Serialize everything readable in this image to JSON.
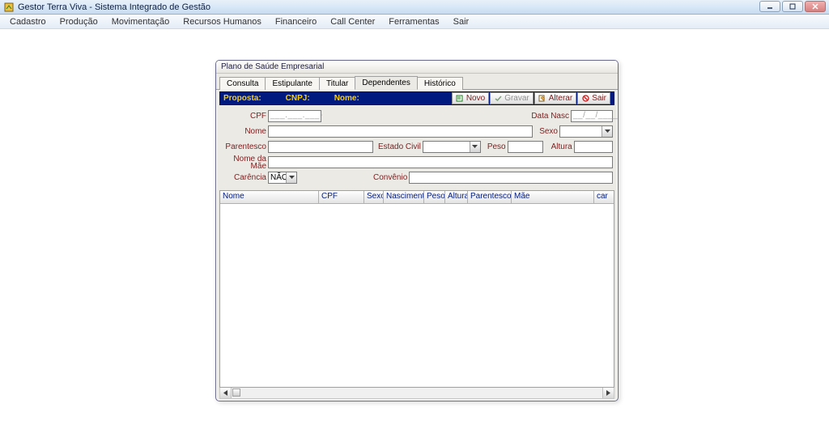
{
  "window": {
    "title": "Gestor Terra Viva - Sistema Integrado de Gestão"
  },
  "menu": {
    "items": [
      "Cadastro",
      "Produção",
      "Movimentação",
      "Recursos Humanos",
      "Financeiro",
      "Call Center",
      "Ferramentas",
      "Sair"
    ]
  },
  "panel": {
    "title": "Plano de Saúde Empresarial",
    "tabs": [
      "Consulta",
      "Estipulante",
      "Titular",
      "Dependentes",
      "Histórico"
    ],
    "active_tab_index": 3
  },
  "bluebar": {
    "proposta_label": "Proposta:",
    "cnpj_label": "CNPJ:",
    "nome_label": "Nome:"
  },
  "toolbar": {
    "novo": "Novo",
    "gravar": "Gravar",
    "alterar": "Alterar",
    "sair": "Sair"
  },
  "form": {
    "cpf_label": "CPF",
    "cpf_mask": "___.___.___-__",
    "data_nasc_label": "Data Nasc",
    "data_nasc_mask": "__/__/____",
    "nome_label": "Nome",
    "sexo_label": "Sexo",
    "parentesco_label": "Parentesco",
    "estado_civil_label": "Estado Civil",
    "peso_label": "Peso",
    "altura_label": "Altura",
    "nome_mae_label": "Nome da Mãe",
    "carencia_label": "Carência",
    "carencia_value": "NÃO",
    "convenio_label": "Convênio"
  },
  "grid": {
    "columns": [
      "Nome",
      "CPF",
      "Sexo",
      "Nascimento",
      "Peso",
      "Altura",
      "Parentesco",
      "Mãe",
      "car"
    ]
  }
}
